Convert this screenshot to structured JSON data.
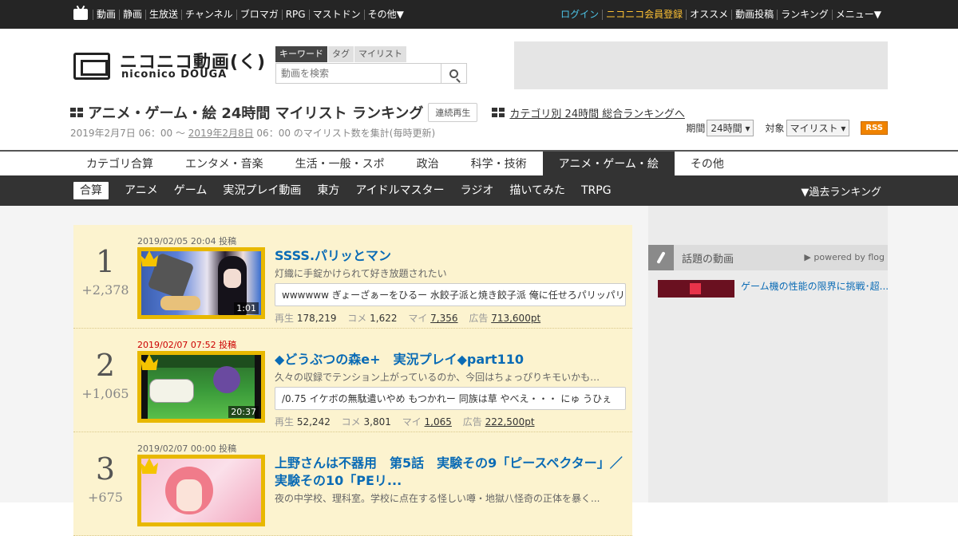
{
  "topbar": {
    "left_links": [
      "動画",
      "静画",
      "生放送",
      "チャンネル",
      "ブロマガ",
      "RPG",
      "マストドン",
      "その他▼"
    ],
    "right_links": {
      "login": "ログイン",
      "premium": "ニコニコ会員登録",
      "others": [
        "オススメ",
        "動画投稿",
        "ランキング",
        "メニュー▼"
      ]
    }
  },
  "logo": {
    "text_jp": "ニコニコ動画(く)",
    "text_en": "niconico DOUGA"
  },
  "search": {
    "tabs": [
      "キーワード",
      "タグ",
      "マイリスト"
    ],
    "placeholder": "動画を検索"
  },
  "ranking": {
    "title": "アニメ・ゲーム・絵 24時間 マイリスト ランキング",
    "continuous_play": "連続再生",
    "overall_link": "カテゴリ別 24時間 総合ランキングへ",
    "period_start": "2019年2月7日 06：00 ～ ",
    "period_end_link": "2019年2月8日",
    "period_rest": " 06：00 のマイリスト数を集計(毎時更新)",
    "period_label": "期間",
    "period_value": "24時間 ▾",
    "target_label": "対象",
    "target_value": "マイリスト ▾",
    "rss": "RSS"
  },
  "categories": [
    "カテゴリ合算",
    "エンタメ・音楽",
    "生活・一般・スポ",
    "政治",
    "科学・技術",
    "アニメ・ゲーム・絵",
    "その他"
  ],
  "active_category": 5,
  "subcategories": [
    "合算",
    "アニメ",
    "ゲーム",
    "実況プレイ動画",
    "東方",
    "アイドルマスター",
    "ラジオ",
    "描いてみた",
    "TRPG"
  ],
  "past_ranking": "▼過去ランキング",
  "videos": [
    {
      "rank": "1",
      "diff": "+2,378",
      "posted": "2019/02/05 20:04 投稿",
      "posted_red": false,
      "title": "SSSS.パリッとマン",
      "desc": "灯織に手錠かけられて好き放題されたい",
      "comment": "wwwwww ぎょーざぁーをひるー 水餃子派と焼き餃子派 俺に任せろパリッパリ",
      "length": "1:01",
      "stats": {
        "play_label": "再生",
        "play": "178,219",
        "comment_label": "コメ",
        "comments": "1,622",
        "mylist_label": "マイ",
        "mylist": "7,356",
        "ad_label": "広告",
        "ad": "713,600pt"
      }
    },
    {
      "rank": "2",
      "diff": "+1,065",
      "posted": "2019/02/07 07:52 投稿",
      "posted_red": true,
      "title": "◆どうぶつの森e+　実況プレイ◆part110",
      "desc": "久々の収録でテンション上がっているのか、今回はちょっぴりキモいかも…",
      "comment": "/0.75 イケボの無駄遣いやめ もつかれー 同族は草 やべえ・・・ にゅ うひぇ",
      "length": "20:37",
      "stats": {
        "play_label": "再生",
        "play": "52,242",
        "comment_label": "コメ",
        "comments": "3,801",
        "mylist_label": "マイ",
        "mylist": "1,065",
        "ad_label": "広告",
        "ad": "222,500pt"
      }
    },
    {
      "rank": "3",
      "diff": "+675",
      "posted": "2019/02/07 00:00 投稿",
      "posted_red": false,
      "title": "上野さんは不器用　第5話　実験その9「ピースペクター」／実験その10「PEリ...",
      "desc": "夜の中学校、理科室。学校に点在する怪しい噂・地獄八怪奇の正体を暴く...",
      "comment": "",
      "length": "",
      "stats": {
        "play_label": "",
        "play": "",
        "comment_label": "",
        "comments": "",
        "mylist_label": "",
        "mylist": "",
        "ad_label": "",
        "ad": ""
      }
    }
  ],
  "sidebar": {
    "topic_title": "話題の動画",
    "powered_by": "▶ powered by flog",
    "topic_item_text": "ゲーム機の性能の限界に挑戦･超..."
  },
  "colors": {
    "topbar": "#252525",
    "accent_blue": "#0a6bb5",
    "item_bg": "#fcf3cf",
    "thumb_border": "#e8b800",
    "rss": "#f08300"
  }
}
